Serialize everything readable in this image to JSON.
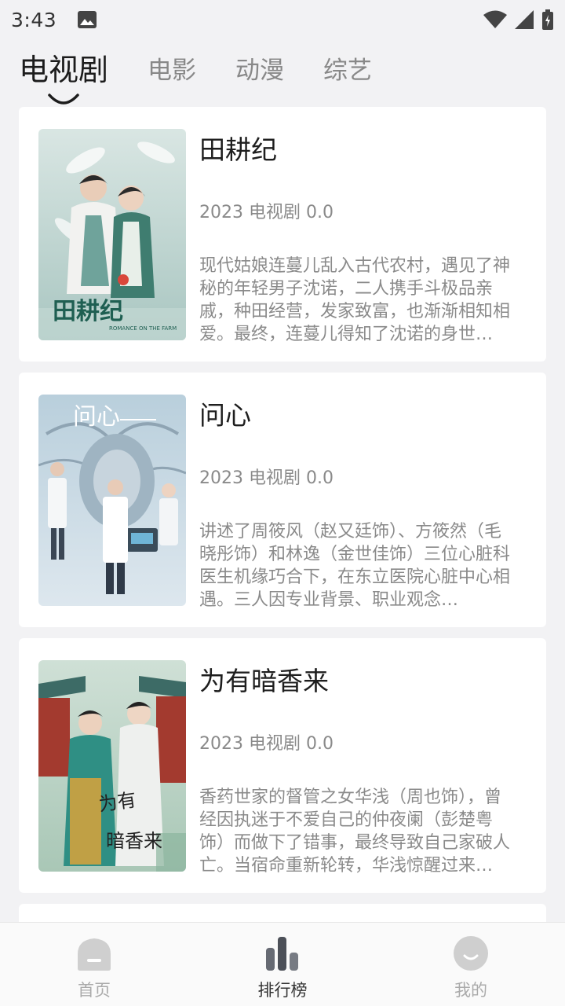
{
  "status": {
    "time": "3:43"
  },
  "tabs": [
    {
      "label": "电视剧",
      "active": true
    },
    {
      "label": "电影",
      "active": false
    },
    {
      "label": "动漫",
      "active": false
    },
    {
      "label": "综艺",
      "active": false
    }
  ],
  "items": [
    {
      "title": "田耕纪",
      "meta": "2023 电视剧 0.0",
      "desc": "现代姑娘连蔓儿乱入古代农村，遇见了神秘的年轻男子沈诺，二人携手斗极品亲戚，种田经营，发家致富，也渐渐相知相爱。最终，连蔓儿得知了沈诺的身世…",
      "poster_text": "田耕纪"
    },
    {
      "title": "问心",
      "meta": "2023 电视剧 0.0",
      "desc": "讲述了周筱风（赵又廷饰）、方筱然（毛晓彤饰）和林逸（金世佳饰）三位心脏科医生机缘巧合下，在东立医院心脏中心相遇。三人因专业背景、职业观念…",
      "poster_text": "问心"
    },
    {
      "title": "为有暗香来",
      "meta": "2023 电视剧 0.0",
      "desc": "香药世家的督管之女华浅（周也饰），曾经因执迷于不爱自己的仲夜阑（彭楚粤饰）而做下了错事，最终导致自己家破人亡。当宿命重新轮转，华浅惊醒过来…",
      "poster_text": "为有暗香来"
    }
  ],
  "nav": [
    {
      "label": "首页",
      "icon": "home-icon",
      "active": false
    },
    {
      "label": "排行榜",
      "icon": "ranking-icon",
      "active": true
    },
    {
      "label": "我的",
      "icon": "profile-icon",
      "active": false
    }
  ]
}
